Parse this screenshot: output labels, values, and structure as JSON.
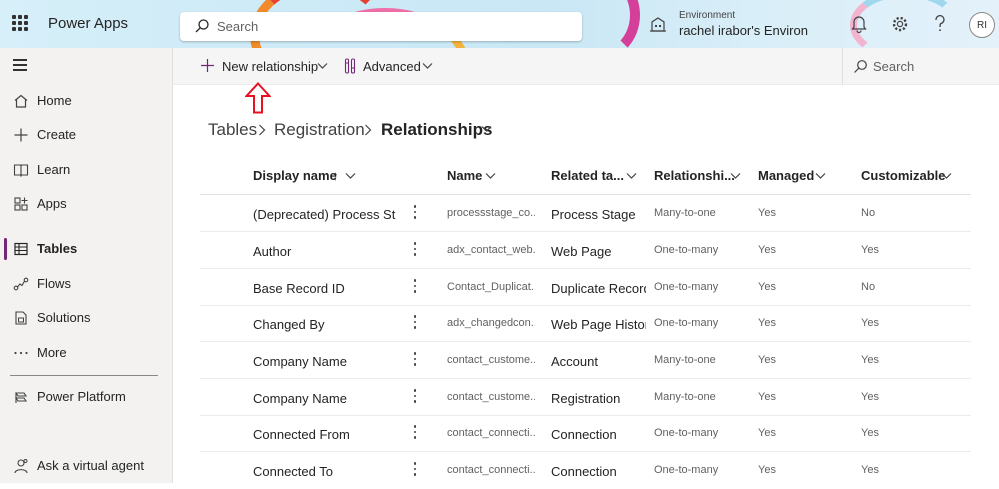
{
  "app": {
    "name": "Power Apps"
  },
  "top_search": {
    "placeholder": "Search"
  },
  "environment": {
    "label": "Environment",
    "name": "rachel irabor's Environ..."
  },
  "user": {
    "initials": "RI"
  },
  "nav": {
    "items": [
      {
        "label": "Home",
        "icon": "home-icon"
      },
      {
        "label": "Create",
        "icon": "plus-icon"
      },
      {
        "label": "Learn",
        "icon": "book-icon"
      },
      {
        "label": "Apps",
        "icon": "apps-icon"
      },
      {
        "label": "Tables",
        "icon": "table-icon",
        "active": true
      },
      {
        "label": "Flows",
        "icon": "flow-icon"
      },
      {
        "label": "Solutions",
        "icon": "solutions-icon"
      },
      {
        "label": "More",
        "icon": "more-icon"
      }
    ],
    "platform": "Power Platform",
    "virtual_agent": "Ask a virtual agent"
  },
  "command_bar": {
    "new_relationship": "New relationship",
    "advanced": "Advanced",
    "search": "Search"
  },
  "breadcrumb": {
    "tables": "Tables",
    "table": "Registration",
    "current": "Relationships"
  },
  "columns": {
    "display_name": "Display name",
    "name": "Name",
    "related_table": "Related ta...",
    "relationship_type": "Relationshi...",
    "managed": "Managed",
    "customizable": "Customizable"
  },
  "rows": [
    {
      "display": "(Deprecated) Process Stag",
      "name": "processstage_co...",
      "related": "Process Stage",
      "type": "Many-to-one",
      "managed": "Yes",
      "customizable": "No"
    },
    {
      "display": "Author",
      "name": "adx_contact_web...",
      "related": "Web Page",
      "type": "One-to-many",
      "managed": "Yes",
      "customizable": "Yes"
    },
    {
      "display": "Base Record ID",
      "name": "Contact_Duplicat...",
      "related": "Duplicate Record",
      "type": "One-to-many",
      "managed": "Yes",
      "customizable": "No"
    },
    {
      "display": "Changed By",
      "name": "adx_changedcon...",
      "related": "Web Page History",
      "type": "One-to-many",
      "managed": "Yes",
      "customizable": "Yes"
    },
    {
      "display": "Company Name",
      "name": "contact_custome...",
      "related": "Account",
      "type": "Many-to-one",
      "managed": "Yes",
      "customizable": "Yes"
    },
    {
      "display": "Company Name",
      "name": "contact_custome...",
      "related": "Registration",
      "type": "Many-to-one",
      "managed": "Yes",
      "customizable": "Yes"
    },
    {
      "display": "Connected From",
      "name": "contact_connecti...",
      "related": "Connection",
      "type": "One-to-many",
      "managed": "Yes",
      "customizable": "Yes"
    },
    {
      "display": "Connected To",
      "name": "contact_connecti...",
      "related": "Connection",
      "type": "One-to-many",
      "managed": "Yes",
      "customizable": "Yes"
    }
  ],
  "colors": {
    "accent": "#742774",
    "annotation_arrow": "#e81123"
  }
}
